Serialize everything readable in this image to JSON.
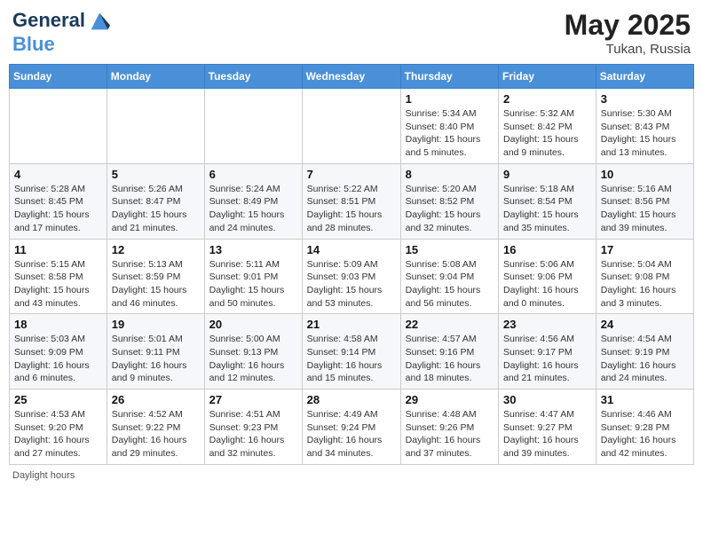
{
  "logo": {
    "line1": "General",
    "line2": "Blue"
  },
  "title": {
    "month_year": "May 2025",
    "location": "Tukan, Russia"
  },
  "weekdays": [
    "Sunday",
    "Monday",
    "Tuesday",
    "Wednesday",
    "Thursday",
    "Friday",
    "Saturday"
  ],
  "weeks": [
    [
      {
        "day": "",
        "info": ""
      },
      {
        "day": "",
        "info": ""
      },
      {
        "day": "",
        "info": ""
      },
      {
        "day": "",
        "info": ""
      },
      {
        "day": "1",
        "info": "Sunrise: 5:34 AM\nSunset: 8:40 PM\nDaylight: 15 hours\nand 5 minutes."
      },
      {
        "day": "2",
        "info": "Sunrise: 5:32 AM\nSunset: 8:42 PM\nDaylight: 15 hours\nand 9 minutes."
      },
      {
        "day": "3",
        "info": "Sunrise: 5:30 AM\nSunset: 8:43 PM\nDaylight: 15 hours\nand 13 minutes."
      }
    ],
    [
      {
        "day": "4",
        "info": "Sunrise: 5:28 AM\nSunset: 8:45 PM\nDaylight: 15 hours\nand 17 minutes."
      },
      {
        "day": "5",
        "info": "Sunrise: 5:26 AM\nSunset: 8:47 PM\nDaylight: 15 hours\nand 21 minutes."
      },
      {
        "day": "6",
        "info": "Sunrise: 5:24 AM\nSunset: 8:49 PM\nDaylight: 15 hours\nand 24 minutes."
      },
      {
        "day": "7",
        "info": "Sunrise: 5:22 AM\nSunset: 8:51 PM\nDaylight: 15 hours\nand 28 minutes."
      },
      {
        "day": "8",
        "info": "Sunrise: 5:20 AM\nSunset: 8:52 PM\nDaylight: 15 hours\nand 32 minutes."
      },
      {
        "day": "9",
        "info": "Sunrise: 5:18 AM\nSunset: 8:54 PM\nDaylight: 15 hours\nand 35 minutes."
      },
      {
        "day": "10",
        "info": "Sunrise: 5:16 AM\nSunset: 8:56 PM\nDaylight: 15 hours\nand 39 minutes."
      }
    ],
    [
      {
        "day": "11",
        "info": "Sunrise: 5:15 AM\nSunset: 8:58 PM\nDaylight: 15 hours\nand 43 minutes."
      },
      {
        "day": "12",
        "info": "Sunrise: 5:13 AM\nSunset: 8:59 PM\nDaylight: 15 hours\nand 46 minutes."
      },
      {
        "day": "13",
        "info": "Sunrise: 5:11 AM\nSunset: 9:01 PM\nDaylight: 15 hours\nand 50 minutes."
      },
      {
        "day": "14",
        "info": "Sunrise: 5:09 AM\nSunset: 9:03 PM\nDaylight: 15 hours\nand 53 minutes."
      },
      {
        "day": "15",
        "info": "Sunrise: 5:08 AM\nSunset: 9:04 PM\nDaylight: 15 hours\nand 56 minutes."
      },
      {
        "day": "16",
        "info": "Sunrise: 5:06 AM\nSunset: 9:06 PM\nDaylight: 16 hours\nand 0 minutes."
      },
      {
        "day": "17",
        "info": "Sunrise: 5:04 AM\nSunset: 9:08 PM\nDaylight: 16 hours\nand 3 minutes."
      }
    ],
    [
      {
        "day": "18",
        "info": "Sunrise: 5:03 AM\nSunset: 9:09 PM\nDaylight: 16 hours\nand 6 minutes."
      },
      {
        "day": "19",
        "info": "Sunrise: 5:01 AM\nSunset: 9:11 PM\nDaylight: 16 hours\nand 9 minutes."
      },
      {
        "day": "20",
        "info": "Sunrise: 5:00 AM\nSunset: 9:13 PM\nDaylight: 16 hours\nand 12 minutes."
      },
      {
        "day": "21",
        "info": "Sunrise: 4:58 AM\nSunset: 9:14 PM\nDaylight: 16 hours\nand 15 minutes."
      },
      {
        "day": "22",
        "info": "Sunrise: 4:57 AM\nSunset: 9:16 PM\nDaylight: 16 hours\nand 18 minutes."
      },
      {
        "day": "23",
        "info": "Sunrise: 4:56 AM\nSunset: 9:17 PM\nDaylight: 16 hours\nand 21 minutes."
      },
      {
        "day": "24",
        "info": "Sunrise: 4:54 AM\nSunset: 9:19 PM\nDaylight: 16 hours\nand 24 minutes."
      }
    ],
    [
      {
        "day": "25",
        "info": "Sunrise: 4:53 AM\nSunset: 9:20 PM\nDaylight: 16 hours\nand 27 minutes."
      },
      {
        "day": "26",
        "info": "Sunrise: 4:52 AM\nSunset: 9:22 PM\nDaylight: 16 hours\nand 29 minutes."
      },
      {
        "day": "27",
        "info": "Sunrise: 4:51 AM\nSunset: 9:23 PM\nDaylight: 16 hours\nand 32 minutes."
      },
      {
        "day": "28",
        "info": "Sunrise: 4:49 AM\nSunset: 9:24 PM\nDaylight: 16 hours\nand 34 minutes."
      },
      {
        "day": "29",
        "info": "Sunrise: 4:48 AM\nSunset: 9:26 PM\nDaylight: 16 hours\nand 37 minutes."
      },
      {
        "day": "30",
        "info": "Sunrise: 4:47 AM\nSunset: 9:27 PM\nDaylight: 16 hours\nand 39 minutes."
      },
      {
        "day": "31",
        "info": "Sunrise: 4:46 AM\nSunset: 9:28 PM\nDaylight: 16 hours\nand 42 minutes."
      }
    ]
  ],
  "footer": {
    "daylight_label": "Daylight hours"
  }
}
